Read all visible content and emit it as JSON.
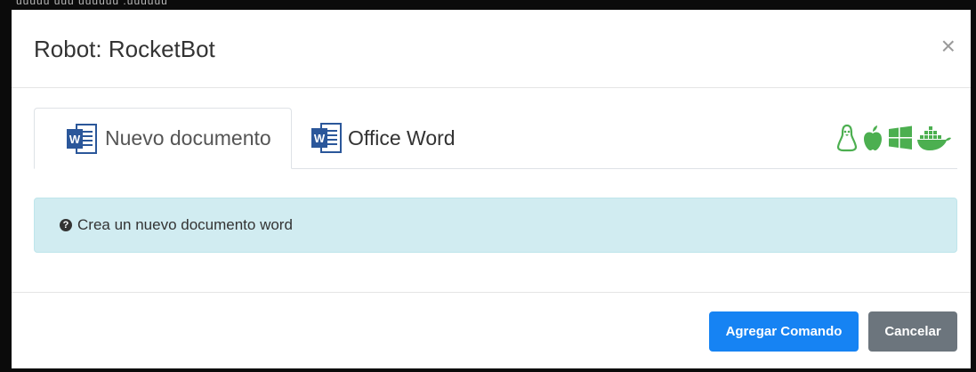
{
  "window_hint": "uuuuu uuu uuuuuu .uuuuuu",
  "modal": {
    "title": "Robot: RocketBot",
    "close_symbol": "×"
  },
  "tabs": [
    {
      "label": "Nuevo documento",
      "icon": "word-document-icon",
      "active": true
    },
    {
      "label": "Office Word",
      "icon": "word-document-icon",
      "active": false
    }
  ],
  "os_icons": [
    "linux-icon",
    "apple-icon",
    "windows-icon",
    "docker-icon"
  ],
  "alert": {
    "icon": "question-circle-icon",
    "text": "Crea un nuevo documento word"
  },
  "footer": {
    "primary_label": "Agregar Comando",
    "secondary_label": "Cancelar"
  },
  "colors": {
    "accent": "#1683f3",
    "secondary": "#6c757d",
    "alert_bg": "#d1ecf1",
    "os_icon_green": "#4caf50",
    "word_blue": "#2b579a"
  }
}
